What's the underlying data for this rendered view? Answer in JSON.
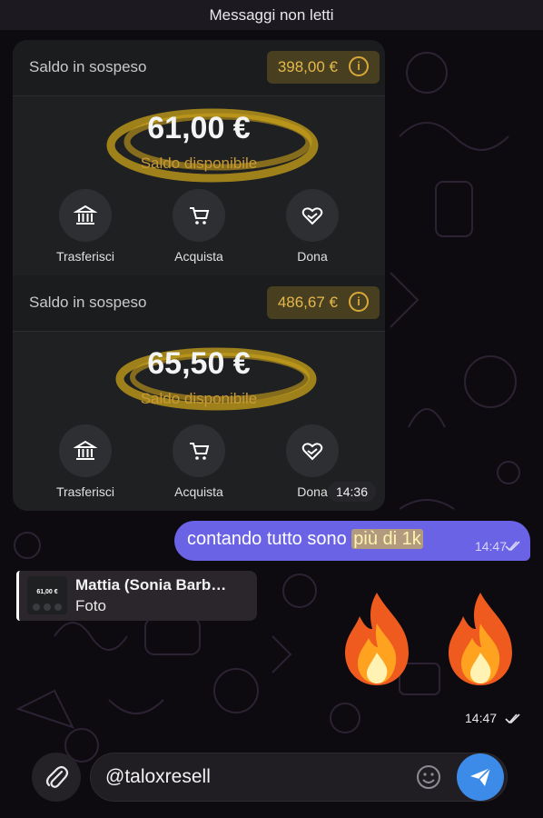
{
  "header": {
    "unread_label": "Messaggi non letti"
  },
  "screenshot_message": {
    "panels": [
      {
        "pending_label": "Saldo in sospeso",
        "pending_amount": "398,00 €",
        "available_amount": "61,00 €",
        "available_label": "Saldo disponibile",
        "actions": [
          "Trasferisci",
          "Acquista",
          "Dona"
        ]
      },
      {
        "pending_label": "Saldo in sospeso",
        "pending_amount": "486,67 €",
        "available_amount": "65,50 €",
        "available_label": "Saldo disponibile",
        "actions": [
          "Trasferisci",
          "Acquista",
          "Dona"
        ]
      }
    ],
    "time": "14:36"
  },
  "outgoing_message": {
    "text_before": "contando tutto sono ",
    "text_highlight": "più di 1k",
    "time": "14:47"
  },
  "reply": {
    "name": "Mattia (Sonia Barb…",
    "subtitle": "Foto",
    "thumb_amount": "61,00 €"
  },
  "emoji_message": {
    "emoji": "🔥🔥",
    "time": "14:47"
  },
  "composer": {
    "input_value": "@taloxresell"
  },
  "colors": {
    "accent_gold": "#e5b84a",
    "outgoing_bubble": "#6b63e6",
    "send_button": "#3d8be8",
    "panel_bg": "#1f2022"
  },
  "icons": [
    "info-icon",
    "bank-icon",
    "cart-icon",
    "heart-hands-icon",
    "paperclip-icon",
    "sticker-icon",
    "send-icon",
    "double-check-icon",
    "fire-emoji"
  ]
}
